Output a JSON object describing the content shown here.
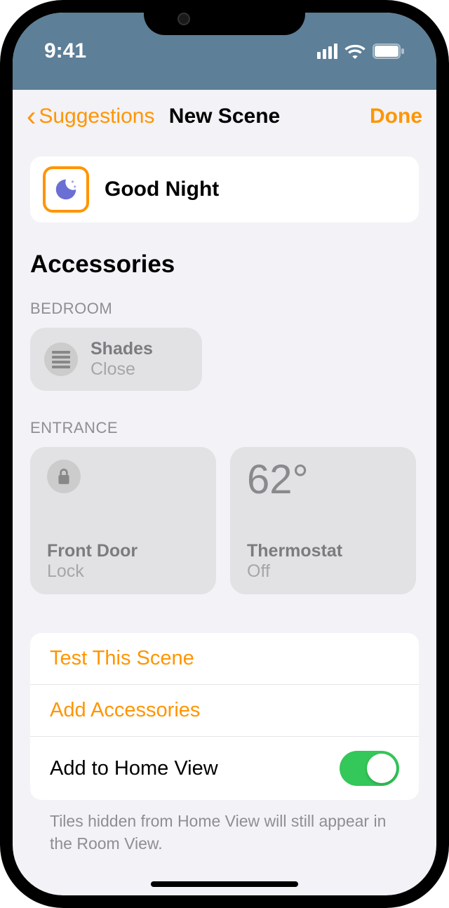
{
  "status": {
    "time": "9:41"
  },
  "nav": {
    "back": "Suggestions",
    "title": "New Scene",
    "done": "Done"
  },
  "scene": {
    "name": "Good Night"
  },
  "section": {
    "accessories": "Accessories"
  },
  "rooms": {
    "bedroom": {
      "label": "BEDROOM",
      "shades": {
        "name": "Shades",
        "status": "Close"
      }
    },
    "entrance": {
      "label": "ENTRANCE",
      "frontdoor": {
        "name": "Front Door",
        "status": "Lock"
      },
      "thermostat": {
        "temp": "62°",
        "name": "Thermostat",
        "status": "Off"
      }
    }
  },
  "options": {
    "test": "Test This Scene",
    "add": "Add Accessories",
    "homeview": "Add to Home View"
  },
  "footer": "Tiles hidden from Home View will still appear in the Room View."
}
